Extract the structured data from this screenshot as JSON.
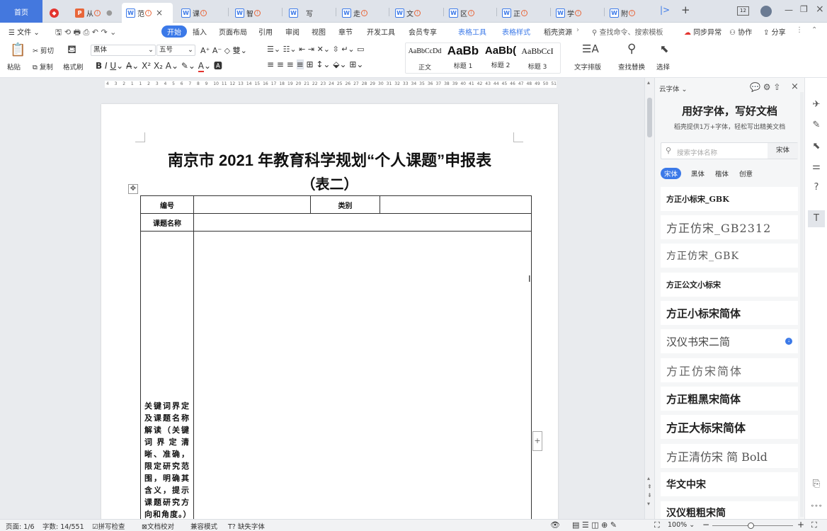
{
  "tabs": {
    "home": "首页",
    "items": [
      {
        "label": "从"
      },
      {
        "label": "范"
      },
      {
        "label": "课"
      },
      {
        "label": "智"
      },
      {
        "label": "写"
      },
      {
        "label": "走"
      },
      {
        "label": "文"
      },
      {
        "label": "区"
      },
      {
        "label": "正"
      },
      {
        "label": "学"
      },
      {
        "label": "附"
      }
    ],
    "right": {
      "pages": "12"
    }
  },
  "menu": {
    "file": "文件",
    "start": "开始",
    "insert": "插入",
    "layout": "页面布局",
    "ref": "引用",
    "review": "审阅",
    "view": "视图",
    "chapter": "章节",
    "dev": "开发工具",
    "vip": "会员专享",
    "table_tools": "表格工具",
    "table_style": "表格样式",
    "daoke": "稻壳资源",
    "search": "查找命令、搜索模板",
    "sync": "同步异常",
    "collab": "协作",
    "share": "分享"
  },
  "ribbon": {
    "paste": "粘贴",
    "cut": "剪切",
    "copy": "复制",
    "format_painter": "格式刷",
    "font_name": "黑体",
    "font_size": "五号",
    "styles": [
      {
        "preview": "AaBbCcDd",
        "name": "正文"
      },
      {
        "preview": "AaBb",
        "name": "标题 1"
      },
      {
        "preview": "AaBb(",
        "name": "标题 2"
      },
      {
        "preview": "AaBbCcI",
        "name": "标题 3"
      }
    ],
    "text_layout": "文字排版",
    "find_replace": "查找替换",
    "select": "选择"
  },
  "ruler": {
    "ticks": [
      "4",
      "3",
      "2",
      "1",
      "1",
      "2",
      "3",
      "4",
      "5",
      "6",
      "7",
      "8",
      "9",
      "10",
      "11",
      "12",
      "13",
      "14",
      "15",
      "16",
      "17",
      "18",
      "19",
      "20",
      "21",
      "22",
      "23",
      "24",
      "25",
      "26",
      "27",
      "28",
      "29",
      "30",
      "31",
      "32",
      "33",
      "34",
      "35",
      "36",
      "37",
      "38",
      "39",
      "40",
      "41",
      "42",
      "43",
      "44",
      "45",
      "46",
      "47",
      "48",
      "49",
      "50",
      "51"
    ]
  },
  "document": {
    "title": "南京市 2021 年教育科学规划“个人课题”申报表",
    "subtitle": "（表二）",
    "table": {
      "row1": {
        "c1": "编号",
        "c3": "类别"
      },
      "row2": {
        "c1": "课题名称"
      },
      "row3_label": "关键词界定及课题名称解读（关键词界定清晰、准确，限定研究范围，明确其含义，提示课题研究方向和角度。）"
    }
  },
  "panel": {
    "title": "云字体",
    "heading": "用好字体，写好文档",
    "subheading": "稻壳提供1万+字体，轻松写出精美文档",
    "search_placeholder": "搜索字体名称",
    "search_tag": "宋体",
    "filters": [
      "宋体",
      "黑体",
      "楷体",
      "创意"
    ],
    "fonts": [
      "方正小标宋_GBK",
      "方正仿宋_GB2312",
      "方正仿宋_GBK",
      "方正公文小标宋",
      "方正小标宋简体",
      "汉仪书宋二简",
      "方正仿宋简体",
      "方正粗黑宋简体",
      "方正大标宋简体",
      "方正清仿宋 简 Bold",
      "华文中宋",
      "汉仪粗粗宋简"
    ]
  },
  "status": {
    "page": "页面: 1/6",
    "words": "字数: 14/551",
    "spell": "拼写检查",
    "proof": "文档校对",
    "compat": "兼容模式",
    "missing_font": "缺失字体",
    "zoom": "100%"
  }
}
